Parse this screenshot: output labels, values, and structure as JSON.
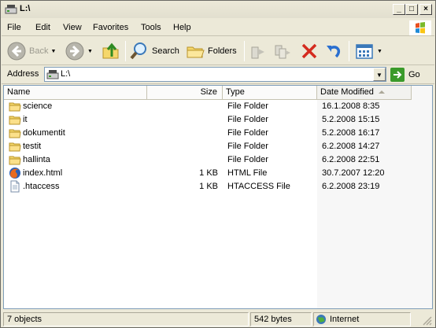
{
  "window": {
    "title": "L:\\"
  },
  "menu": {
    "items": [
      "File",
      "Edit",
      "View",
      "Favorites",
      "Tools",
      "Help"
    ]
  },
  "toolbar": {
    "back_label": "Back",
    "search_label": "Search",
    "folders_label": "Folders"
  },
  "address": {
    "label": "Address",
    "value": "L:\\",
    "go_label": "Go"
  },
  "list": {
    "columns": [
      "Name",
      "Size",
      "Type",
      "Date Modified"
    ],
    "sorted_column": "Date Modified",
    "rows": [
      {
        "icon": "folder-icon",
        "name": "science",
        "size": "",
        "type": "File Folder",
        "date": "16.1.2008 8:35"
      },
      {
        "icon": "folder-icon",
        "name": "it",
        "size": "",
        "type": "File Folder",
        "date": "5.2.2008 15:15"
      },
      {
        "icon": "folder-icon",
        "name": "dokumentit",
        "size": "",
        "type": "File Folder",
        "date": "5.2.2008 16:17"
      },
      {
        "icon": "folder-icon",
        "name": "testit",
        "size": "",
        "type": "File Folder",
        "date": "6.2.2008 14:27"
      },
      {
        "icon": "folder-icon",
        "name": "hallinta",
        "size": "",
        "type": "File Folder",
        "date": "6.2.2008 22:51"
      },
      {
        "icon": "firefox-html-icon",
        "name": "index.html",
        "size": "1 KB",
        "type": "HTML File",
        "date": "30.7.2007 12:20"
      },
      {
        "icon": "generic-file-icon",
        "name": ".htaccess",
        "size": "1 KB",
        "type": "HTACCESS File",
        "date": "6.2.2008 23:19"
      }
    ]
  },
  "status": {
    "objects": "7 objects",
    "size": "542 bytes",
    "zone": "Internet"
  },
  "colors": {
    "folder": "#f5d76b",
    "go_green": "#3a9a2a",
    "delete_red": "#d42b1f",
    "undo_blue": "#2a6fd0"
  }
}
